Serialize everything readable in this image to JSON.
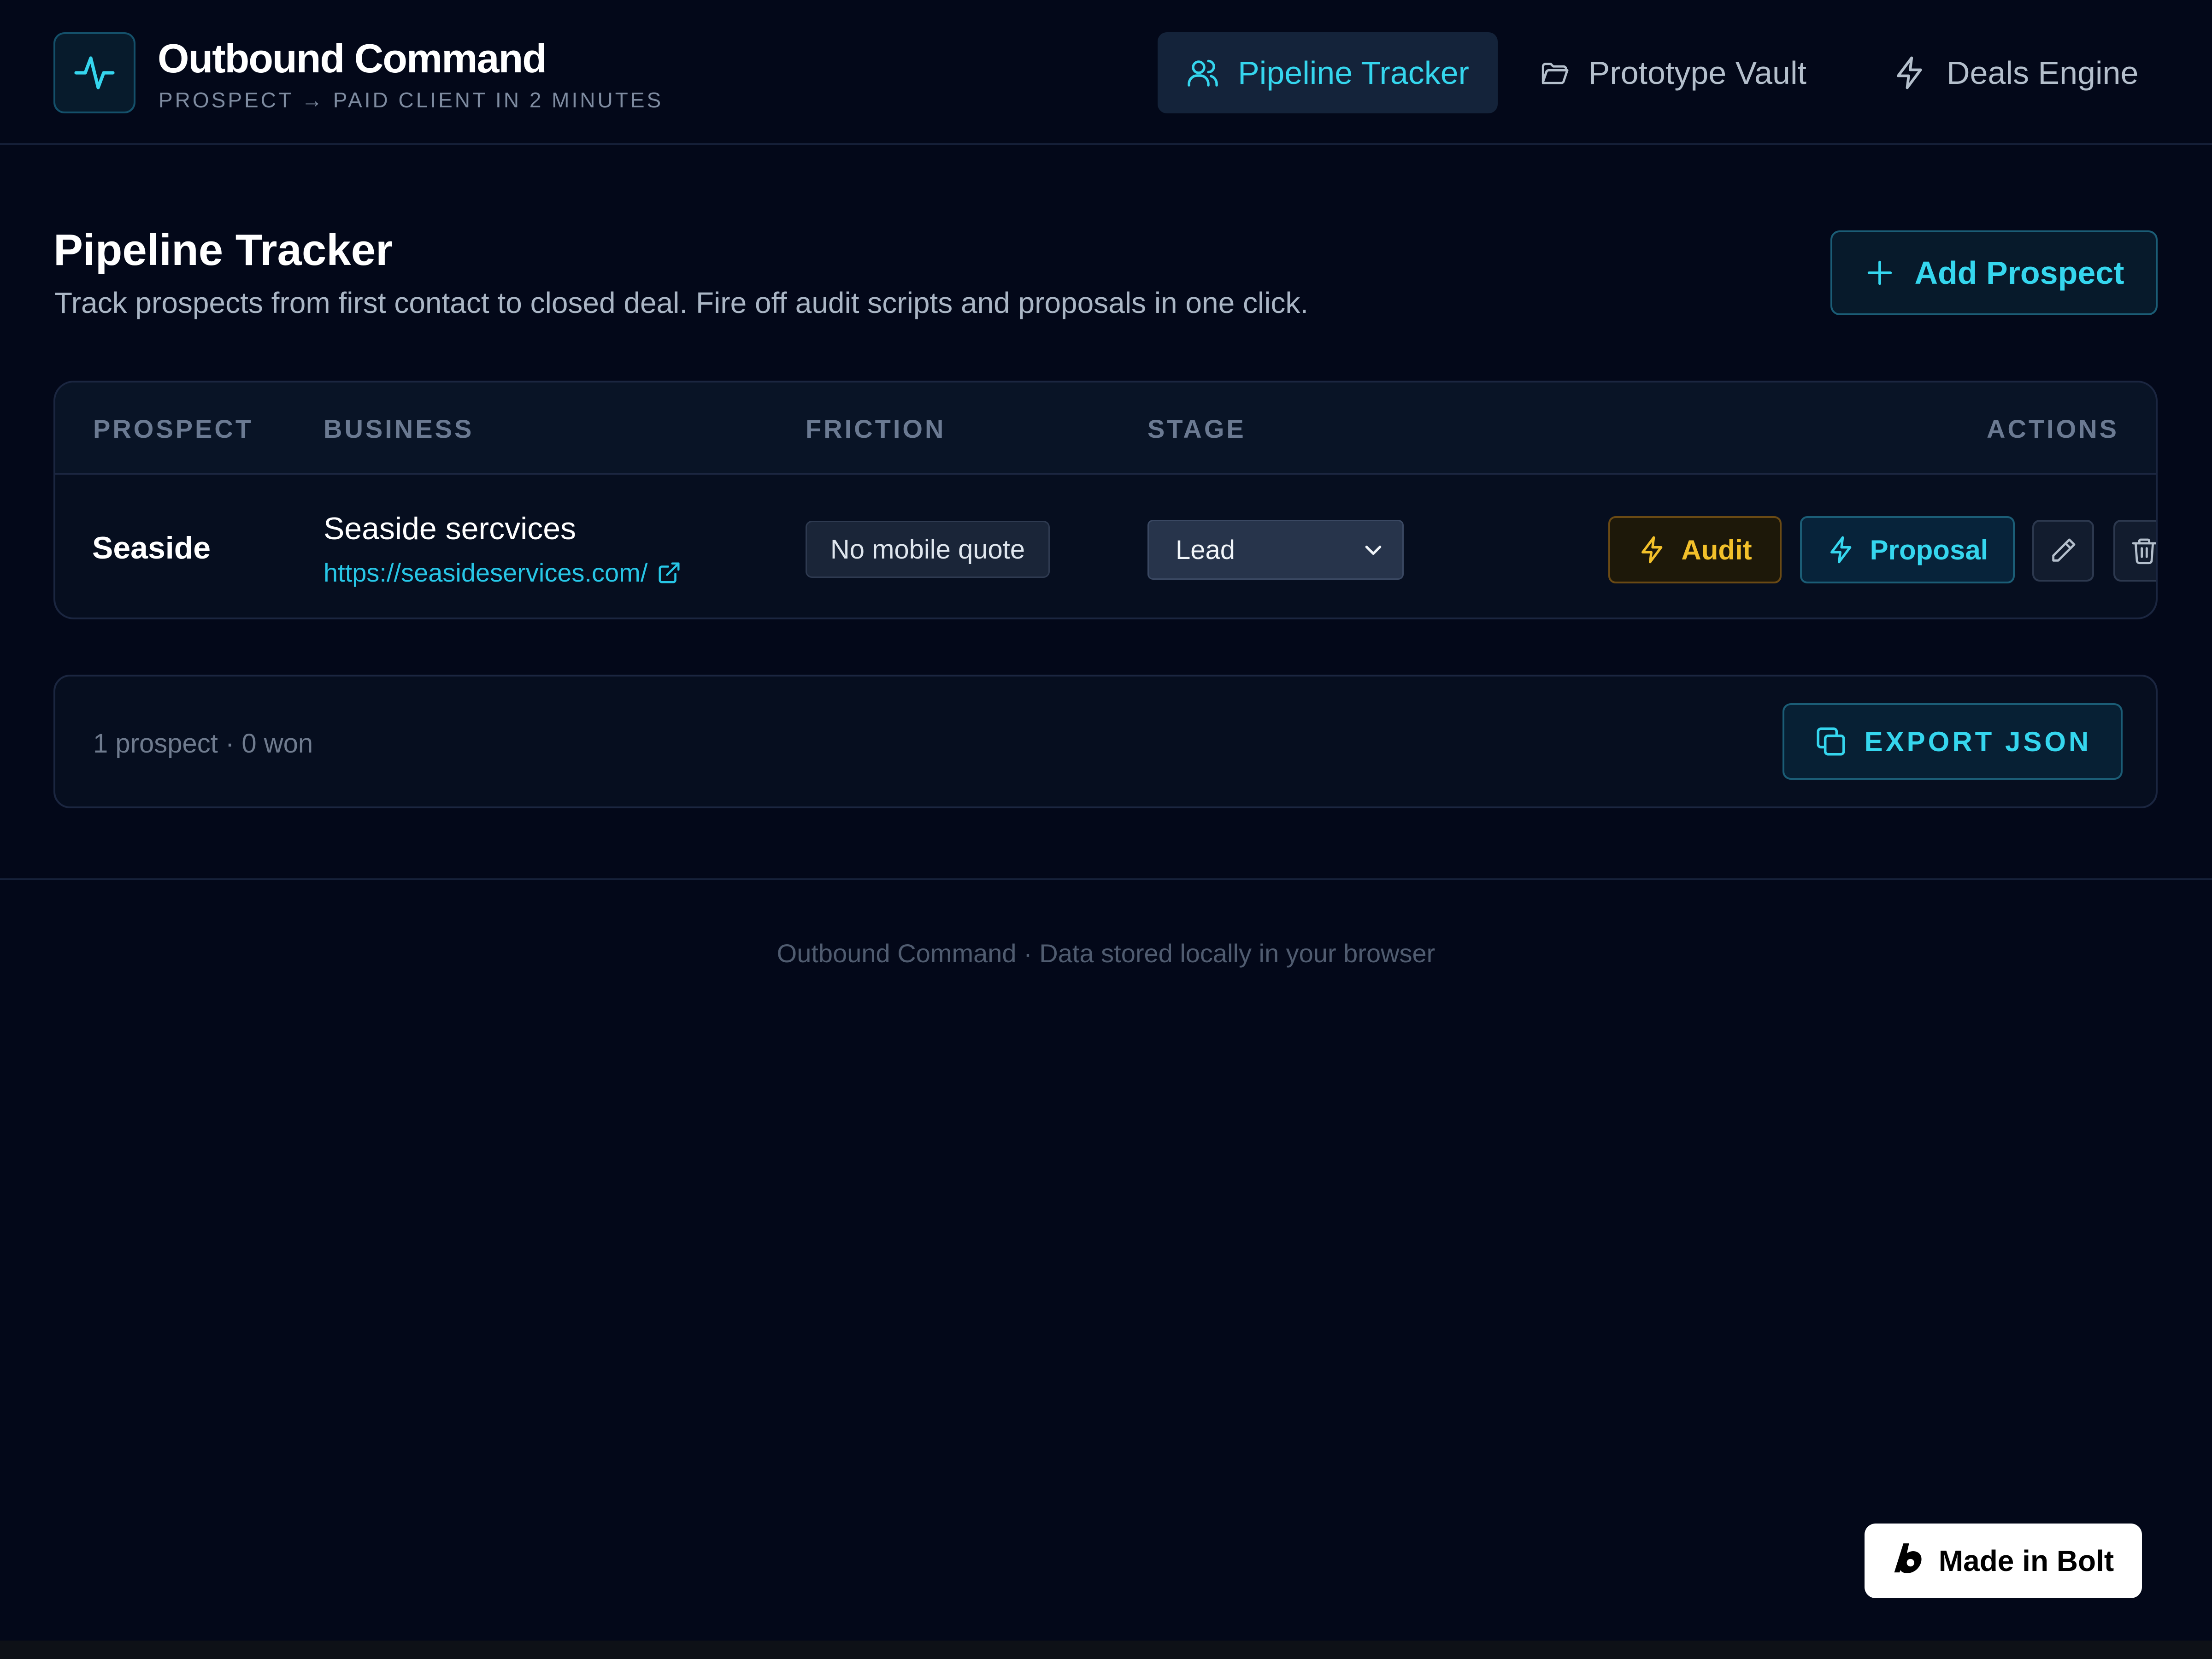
{
  "app": {
    "title": "Outbound Command",
    "subtitle": "PROSPECT → PAID CLIENT IN 2 MINUTES",
    "logo_icon": "activity-pulse-icon"
  },
  "nav": {
    "tabs": [
      {
        "label": "Pipeline Tracker",
        "icon": "users-icon",
        "active": true
      },
      {
        "label": "Prototype Vault",
        "icon": "folder-icon",
        "active": false
      },
      {
        "label": "Deals Engine",
        "icon": "lightning-icon",
        "active": false
      }
    ]
  },
  "page": {
    "title": "Pipeline Tracker",
    "subtitle": "Track prospects from first contact to closed deal. Fire off audit scripts and proposals in one click.",
    "add_button": "Add Prospect"
  },
  "table": {
    "headers": [
      "PROSPECT",
      "BUSINESS",
      "FRICTION",
      "STAGE",
      "ACTIONS"
    ],
    "rows": [
      {
        "prospect": "Seaside",
        "business": "Seaside sercvices",
        "url": "https://seasideservices.com/",
        "friction": "No mobile quote",
        "stage": "Lead",
        "actions": {
          "audit": "Audit",
          "proposal": "Proposal"
        }
      }
    ]
  },
  "summary": {
    "text": "1 prospect · 0 won",
    "export_button": "EXPORT JSON"
  },
  "footer": {
    "text": "Outbound Command · Data stored locally in your browser"
  },
  "badge": {
    "label": "Made in Bolt"
  },
  "colors": {
    "background": "#030819",
    "accent": "#35d6ee",
    "audit": "#f2c02a",
    "border": "#1b2640"
  }
}
